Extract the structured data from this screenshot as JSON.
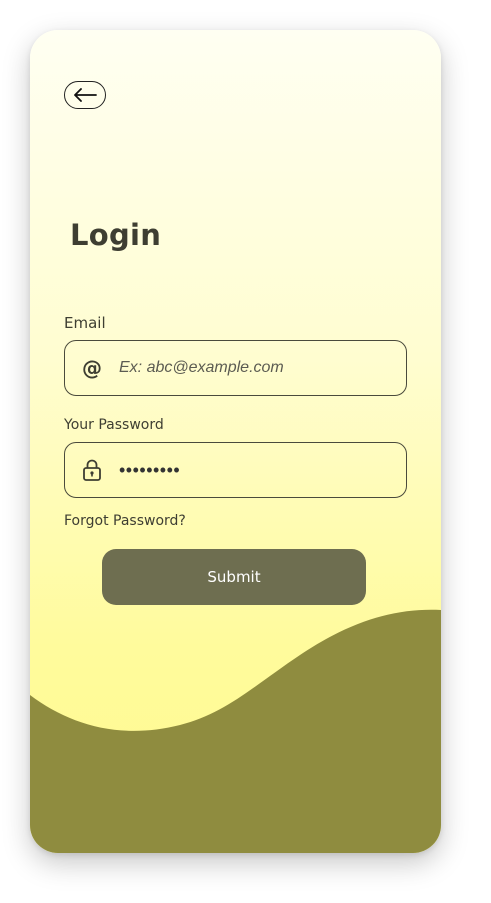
{
  "screen": {
    "title": "Login"
  },
  "form": {
    "email": {
      "label": "Email",
      "icon": "at-sign-icon",
      "value": "",
      "placeholder": "Ex: abc@example.com"
    },
    "password": {
      "label": "Your Password",
      "icon": "lock-icon",
      "value": "•••••••••",
      "placeholder": ""
    },
    "forgot_label": "Forgot Password?",
    "submit_label": "Submit"
  },
  "icons": {
    "back": "back-arrow-icon",
    "at": "@"
  },
  "colors": {
    "background_top": "#fffff2",
    "background_bottom": "#fffa8e",
    "wave": "#8f8c3f",
    "button": "#6e6e50",
    "text": "#3e3e32"
  }
}
